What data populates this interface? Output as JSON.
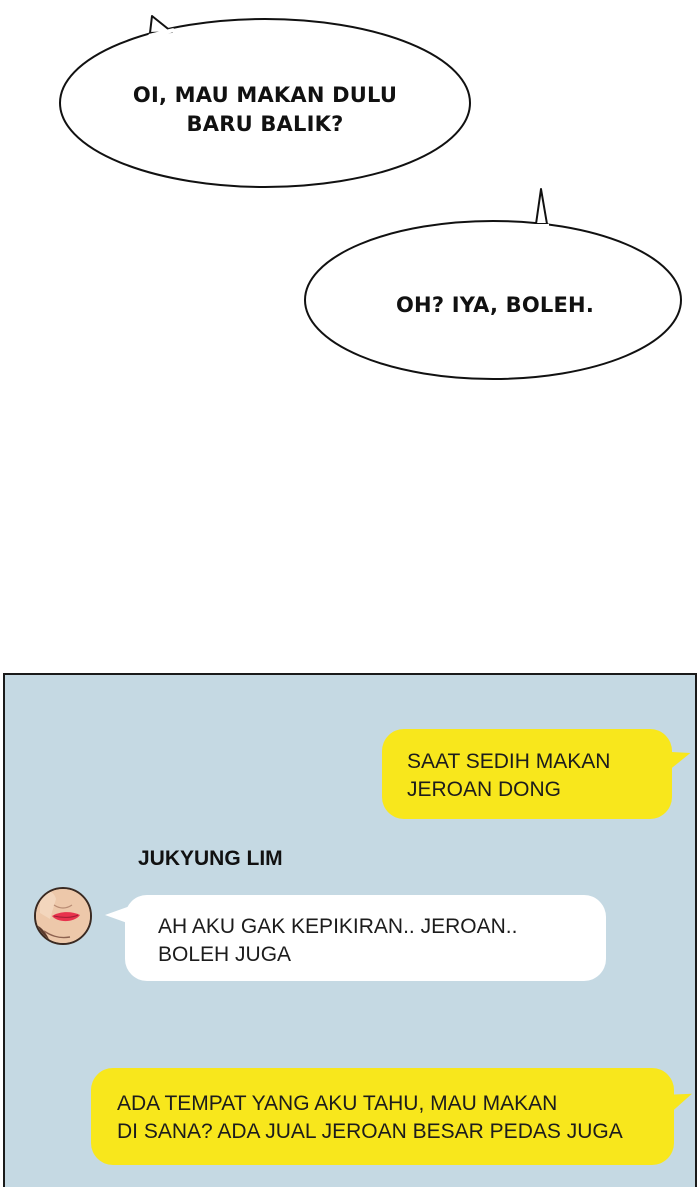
{
  "speech_bubbles": [
    {
      "lines": [
        "OI, MAU MAKAN DULU",
        "BARU BALIK?"
      ]
    },
    {
      "lines": [
        "OH? IYA, BOLEH."
      ]
    }
  ],
  "chat": {
    "background_color": "#c5d9e3",
    "outgoing_color": "#f8e71c",
    "incoming_color": "#ffffff",
    "messages": [
      {
        "direction": "outgoing",
        "lines": [
          "SAAT SEDIH MAKAN",
          "JEROAN DONG"
        ]
      },
      {
        "direction": "incoming",
        "sender": "JUKYUNG LIM",
        "lines": [
          "AH AKU GAK KEPIKIRAN.. JEROAN..",
          "BOLEH JUGA"
        ]
      },
      {
        "direction": "outgoing",
        "lines": [
          "ADA TEMPAT YANG AKU TAHU, MAU MAKAN",
          "DI SANA? ADA JUAL JEROAN BESAR PEDAS JUGA"
        ]
      }
    ]
  }
}
